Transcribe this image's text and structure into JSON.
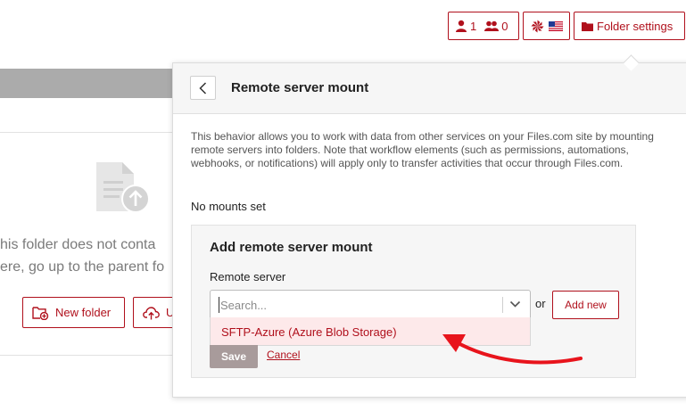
{
  "header": {
    "users_count": "1",
    "groups_count": "0",
    "folder_settings_label": "Folder settings"
  },
  "background": {
    "empty_text_line1": "his folder does not conta",
    "empty_text_line2": "ere, go up to the parent fo",
    "new_folder_label": "New folder",
    "upload_label": "U"
  },
  "panel": {
    "title": "Remote server mount",
    "description": "This behavior allows you to work with data from other services on your Files.com site by mounting remote servers into folders. Note that workflow elements (such as permissions, automations, webhooks, or notifications) will apply only to transfer activities that occur through Files.com.",
    "no_mounts": "No mounts set",
    "add_section": {
      "title": "Add remote server mount",
      "field_label": "Remote server",
      "search_placeholder": "Search...",
      "search_value": "",
      "options": [
        "SFTP-Azure (Azure Blob Storage)"
      ],
      "or_text": "or",
      "add_new_label": "Add new",
      "save_label": "Save",
      "cancel_label": "Cancel"
    }
  },
  "colors": {
    "brand": "#b0101c",
    "annotation_arrow": "#e8141c",
    "option_highlight": "#fde9ea"
  },
  "icons": [
    "user-icon",
    "users-icon",
    "files-logo-icon",
    "us-flag-icon",
    "folder-icon",
    "file-upload-icon",
    "chevron-left-icon",
    "chevron-down-icon",
    "folder-plus-icon",
    "cloud-upload-icon",
    "annotation-arrow"
  ]
}
